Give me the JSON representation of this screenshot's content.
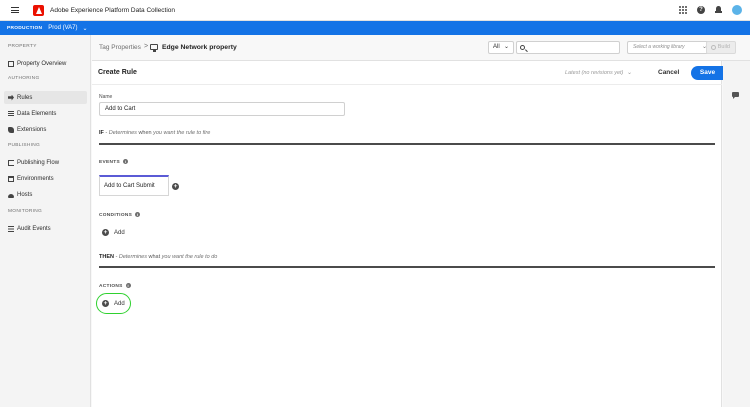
{
  "app": {
    "title": "Adobe Experience Platform Data Collection"
  },
  "environment": {
    "label": "PRODUCTION",
    "value": "Prod (VA7)"
  },
  "sidebar": {
    "sections": [
      {
        "label": "PROPERTY"
      },
      {
        "label": "AUTHORING"
      },
      {
        "label": "PUBLISHING"
      },
      {
        "label": "MONITORING"
      }
    ],
    "items": [
      {
        "label": "Property Overview",
        "icon": "document-icon"
      },
      {
        "label": "Rules",
        "icon": "rules-icon",
        "active": true
      },
      {
        "label": "Data Elements",
        "icon": "data-elements-icon"
      },
      {
        "label": "Extensions",
        "icon": "extensions-icon"
      },
      {
        "label": "Publishing Flow",
        "icon": "publishing-flow-icon"
      },
      {
        "label": "Environments",
        "icon": "environments-icon"
      },
      {
        "label": "Hosts",
        "icon": "cloud-icon"
      },
      {
        "label": "Audit Events",
        "icon": "audit-list-icon"
      }
    ]
  },
  "breadcrumb": {
    "parent": "Tag Properties",
    "separator": ">",
    "current": "Edge Network property"
  },
  "toolbar": {
    "filter_value": "All",
    "search_placeholder": "",
    "library_placeholder": "Select a working library",
    "build_label": "Build"
  },
  "rule": {
    "header_title": "Create Rule",
    "revision_text": "Latest (no revisions yet)",
    "cancel_label": "Cancel",
    "save_label": "Save",
    "name_label": "Name",
    "name_value": "Add to Cart",
    "if_keyword": "IF",
    "if_text_before": " - Determines ",
    "if_text_bold": "when",
    "if_text_after": " you want the rule to fire",
    "events_label": "EVENTS",
    "event_card_label": "Add to Cart Submit",
    "conditions_label": "CONDITIONS",
    "conditions_add_label": "Add",
    "then_keyword": "THEN",
    "then_text_before": " - Determines ",
    "then_text_bold": "what",
    "then_text_after": " you want the rule to do",
    "actions_label": "ACTIONS",
    "actions_add_label": "Add"
  },
  "colors": {
    "accent": "#1473e6",
    "brand": "#eb1000",
    "event_stripe": "#5b5bd6",
    "highlight": "#2fd12f"
  }
}
